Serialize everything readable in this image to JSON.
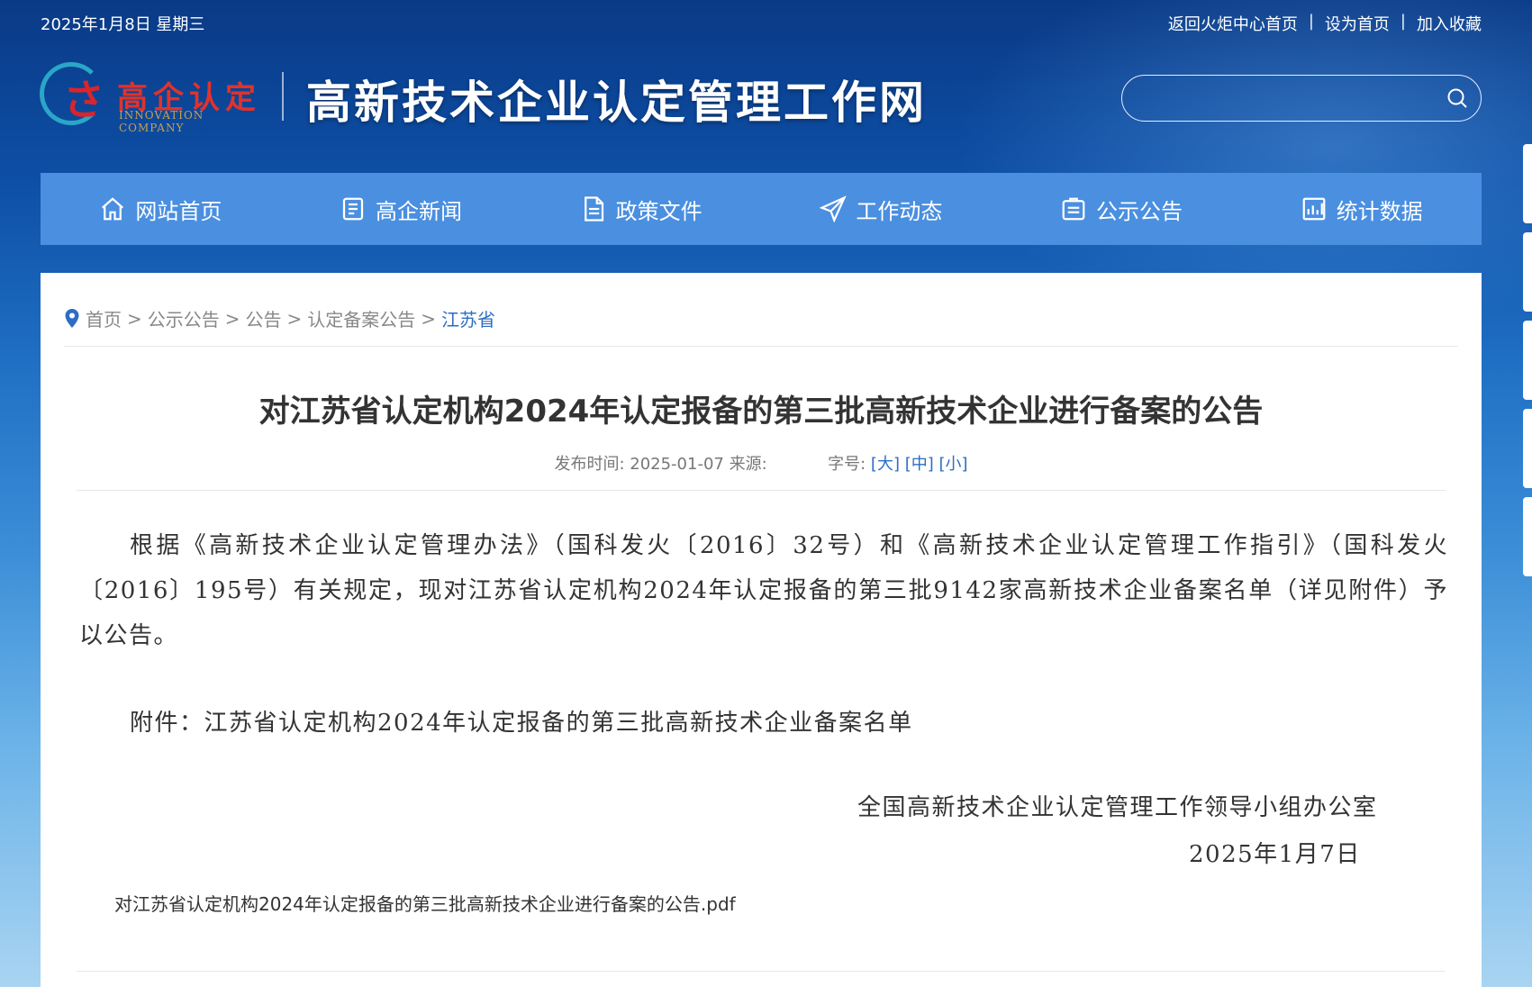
{
  "header": {
    "date": "2025年1月8日 星期三",
    "links": [
      "返回火炬中心首页",
      "设为首页",
      "加入收藏"
    ],
    "link_separator": "|",
    "logo_cn": "高企认定",
    "logo_en": "INNOVATION COMPANY",
    "site_title": "高新技术企业认定管理工作网",
    "search": {
      "value": "",
      "placeholder": ""
    }
  },
  "nav": {
    "items": [
      {
        "label": "网站首页",
        "icon": "home-icon"
      },
      {
        "label": "高企新闻",
        "icon": "news-icon"
      },
      {
        "label": "政策文件",
        "icon": "document-icon"
      },
      {
        "label": "工作动态",
        "icon": "paper-plane-icon"
      },
      {
        "label": "公示公告",
        "icon": "notice-icon"
      },
      {
        "label": "统计数据",
        "icon": "chart-icon"
      }
    ]
  },
  "breadcrumb": {
    "items": [
      "首页",
      "公示公告",
      "公告",
      "认定备案公告",
      "江苏省"
    ],
    "separator": ">"
  },
  "article": {
    "title": "对江苏省认定机构2024年认定报备的第三批高新技术企业进行备案的公告",
    "meta_published": "发布时间: 2025-01-07 来源:",
    "meta_font_label": "字号:",
    "font_sizes": [
      "[大]",
      "[中]",
      "[小]"
    ],
    "paragraph1": "根据《高新技术企业认定管理办法》（国科发火〔2016〕32号）和《高新技术企业认定管理工作指引》（国科发火〔2016〕195号）有关规定，现对江苏省认定机构2024年认定报备的第三批9142家高新技术企业备案名单（详见附件）予以公告。",
    "paragraph2": "附件：江苏省认定机构2024年认定报备的第三批高新技术企业备案名单",
    "signature_org": "全国高新技术企业认定管理工作领导小组办公室",
    "signature_date": "2025年1月7日",
    "attachment": "对江苏省认定机构2024年认定报备的第三批高新技术企业进行备案的公告.pdf"
  }
}
